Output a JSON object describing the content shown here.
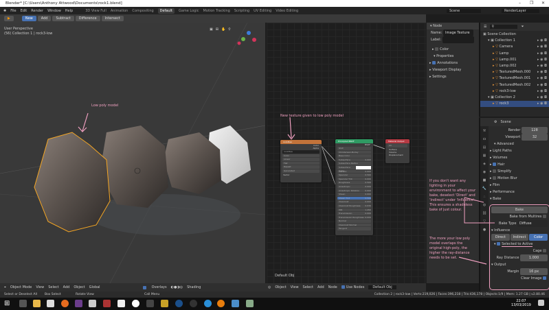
{
  "window": {
    "title": "Blender* [C:\\Users\\Anthony Attwood\\Documents\\rock1.blend]",
    "controls": [
      "–",
      "❐",
      "✕"
    ]
  },
  "menu": {
    "items": [
      "File",
      "Edit",
      "Render",
      "Window",
      "Help"
    ],
    "workspaces": [
      "3D View Full",
      "Animation",
      "Compositing",
      "Default",
      "Game Logic",
      "Motion Tracking",
      "Scripting",
      "UV Editing",
      "Video Editing"
    ],
    "active_workspace": "Default",
    "scene": "Scene",
    "render_layer": "RenderLayer"
  },
  "toolheader": {
    "buttons": [
      "New",
      "Add",
      "Subtract",
      "Difference",
      "Intersect"
    ],
    "active": "New"
  },
  "viewport": {
    "perspective": "User Perspective",
    "collection": "(56) Collection 1 | rock3-low",
    "annotation": "Low poly model",
    "header": {
      "mode": "Object Mode",
      "menus": [
        "View",
        "Select",
        "Add",
        "Object"
      ],
      "orientation": "Global",
      "overlays": "Overlays",
      "shading": "Shading"
    }
  },
  "node_editor": {
    "annotation": "New texture given to low poly model",
    "material": "Default Obj",
    "footer_label": "Default Obj",
    "header": {
      "type": "Object",
      "menus": [
        "View",
        "Select",
        "Add",
        "Node"
      ],
      "use_nodes": "Use Nodes"
    },
    "image_node": {
      "title": "rock3tex",
      "outputs": [
        "Color",
        "Alpha"
      ],
      "image": "rock3tex",
      "rows": [
        "Color",
        "Linear",
        "Flat",
        "Repeat",
        "Generated",
        "Vector"
      ]
    },
    "bsdf_node": {
      "title": "Principled BSDF",
      "output": "BSDF",
      "rows": [
        [
          "GGX",
          ""
        ],
        [
          "Christensen-Burley",
          ""
        ],
        [
          "Base Color",
          ""
        ],
        [
          "Subsurface",
          "0.000"
        ],
        [
          "Subsurface Radius",
          ""
        ],
        [
          "Subsurface Color",
          ""
        ],
        [
          "Metallic",
          "0.000"
        ],
        [
          "Specular",
          "0.500"
        ],
        [
          "Specular Tint",
          "0.000"
        ],
        [
          "Roughness",
          "0.500"
        ],
        [
          "Anisotropic",
          "0.000"
        ],
        [
          "Anisotropic Rotation",
          "0.000"
        ],
        [
          "Sheen",
          "0.000"
        ],
        [
          "Sheen Tint",
          "0.500"
        ],
        [
          "Clearcoat",
          "0.000"
        ],
        [
          "Clearcoat Roughness",
          "0.030"
        ],
        [
          "IOR",
          "1.450"
        ],
        [
          "Transmission",
          "0.000"
        ],
        [
          "Transmission Roughness",
          "0.000"
        ],
        [
          "Normal",
          ""
        ],
        [
          "Clearcoat Normal",
          ""
        ],
        [
          "Tangent",
          ""
        ]
      ]
    },
    "output_node": {
      "title": "Material Output",
      "target": "All",
      "inputs": [
        "Surface",
        "Volume",
        "Displacement"
      ]
    }
  },
  "npanel": {
    "section": "Node",
    "name_label": "Name:",
    "name_value": "Image Texture",
    "label_label": "Label:",
    "color": "Color",
    "properties": "Properties",
    "annotations": "Annotations",
    "viewport_display": "Viewport Display",
    "settings": "Settings"
  },
  "outliner": {
    "items": [
      {
        "label": "Scene Collection",
        "level": 0
      },
      {
        "label": "Collection 1",
        "level": 1
      },
      {
        "label": "Camera",
        "level": 2
      },
      {
        "label": "Lamp",
        "level": 2
      },
      {
        "label": "Lamp.001",
        "level": 2
      },
      {
        "label": "Lamp.002",
        "level": 2
      },
      {
        "label": "TexturedMesh.000",
        "level": 2
      },
      {
        "label": "TexturedMesh.001",
        "level": 2
      },
      {
        "label": "TexturedMesh.002",
        "level": 2
      },
      {
        "label": "rock3-low",
        "level": 2
      },
      {
        "label": "Collection 2",
        "level": 1
      },
      {
        "label": "rock3",
        "level": 2,
        "selected": true
      }
    ]
  },
  "properties": {
    "scene": "Scene",
    "render_label": "Render",
    "render_value": "128",
    "viewport_label": "Viewport",
    "viewport_value": "32",
    "sections": [
      "Advanced",
      "Light Paths",
      "Volumes",
      "Hair",
      "Simplify",
      "Motion Blur",
      "Film",
      "Performance",
      "Bake"
    ],
    "bake": {
      "button": "Bake",
      "from_multires": "Bake from Multires",
      "type_label": "Bake Type",
      "type_value": "Diffuse",
      "influence": "Influence",
      "tabs": [
        "Direct",
        "Indirect",
        "Color"
      ],
      "active_tab": "Color",
      "selected_to_active": "Selected to Active",
      "cage": "Cage",
      "ray_distance_label": "Ray Distance",
      "ray_distance_value": "1.000",
      "output": "Output",
      "margin_label": "Margin",
      "margin_value": "16 px",
      "clear_image": "Clear Image"
    }
  },
  "notes": {
    "influence": "If you don't want any lighting in your environment to affect your bake, deselect 'Direct' and 'Indirect' under 'Influence'. This ensures a shadeless bake of just colour.",
    "ray": "The more your low poly model overlaps the original high-poly, the higher the ray-distance needs to be set."
  },
  "statusbar": {
    "left": [
      "Select or Deselect All",
      "Box Select",
      "Rotate View"
    ],
    "mid": "Call Menu",
    "right": "Collection 2 | rock3-low | Verts:219,026 | Faces:396,218 | Tris:436,178 | Objects:1/9 | Mem: 1.27 GB | v2.80.46"
  },
  "taskbar": {
    "time": "22:07",
    "date": "13/03/2019"
  },
  "colors": {
    "accent": "#4772b3",
    "annotation": "#f0a0c0",
    "selection": "#f5a623"
  }
}
